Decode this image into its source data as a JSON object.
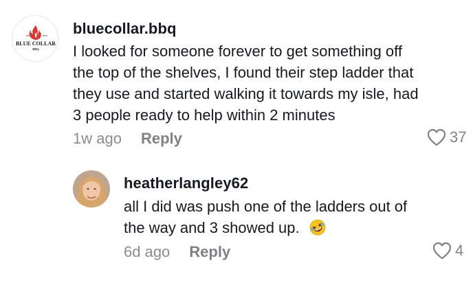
{
  "comments": [
    {
      "username": "bluecollar.bbq",
      "avatar_icon": "blue-collar-bbq-logo",
      "avatar_text": {
        "top": "BLUE COLLAR",
        "bottom": "BBQ",
        "small_left": "EST",
        "small_right": "2020"
      },
      "lines": [
        "I looked for someone forever to get something off",
        "the top of the shelves, I found their step ladder that",
        "they use and started walking it towards my isle, had",
        "3 people ready to help within 2 minutes"
      ],
      "time": "1w ago",
      "reply_label": "Reply",
      "like_count": "37"
    },
    {
      "username": "heatherlangley62",
      "avatar_icon": "user-photo",
      "lines": [
        "all I did was push one of the ladders out of",
        "the way and 3 showed up."
      ],
      "emoji": "rolling-on-floor-laughing",
      "time": "6d ago",
      "reply_label": "Reply",
      "like_count": "4"
    }
  ],
  "colors": {
    "text": "#161823",
    "muted": "#8a8b91",
    "logo_red": "#e0352b"
  }
}
